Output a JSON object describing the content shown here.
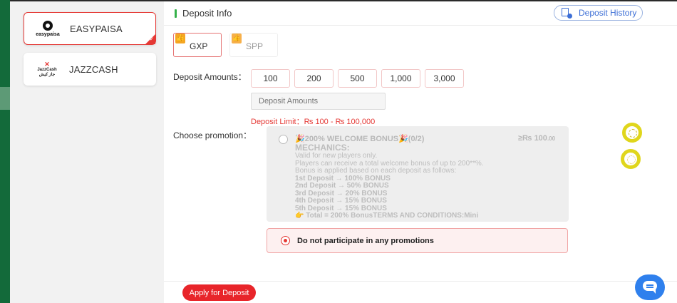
{
  "sidebar": {
    "methods": [
      {
        "name": "EASYPAISA",
        "logo_text": "easypaisa",
        "active": true
      },
      {
        "name": "JAZZCASH",
        "logo_text": "JazzCash",
        "logo_subtext": "جاز کیش",
        "active": false
      }
    ]
  },
  "header": {
    "title": "Deposit Info",
    "history_button": "Deposit History"
  },
  "currencies": [
    {
      "label": "GXP",
      "active": true
    },
    {
      "label": "SPP",
      "active": false
    }
  ],
  "deposit": {
    "amounts_label": "Deposit Amounts：",
    "amounts": [
      "100",
      "200",
      "500",
      "1,000",
      "3,000"
    ],
    "amount_placeholder": "Deposit Amounts",
    "limit_text": "Deposit Limit：₨ 100 - ₨ 100,000"
  },
  "promotion": {
    "label": "Choose promotion：",
    "title": "🎉200% WELCOME BONUS🎉(0/2)",
    "amount": "≥₨ 100",
    "amount_decimals": ".00",
    "mechanics_heading": "MECHANICS:",
    "lines": [
      "Valid for new players only.",
      "Players can receive a total welcome bonus of up to 200**%.",
      "Bonus is applied based on each deposit as follows:",
      "1st Deposit → 100% BONUS",
      "2nd Deposit → 50% BONUS",
      "3rd Deposit → 20% BONUS",
      "4th Deposit → 15% BONUS",
      "5th Deposit → 15% BONUS",
      "👉 Total = 200% BonusTERMS AND CONDITIONS:Mini"
    ],
    "no_promo_label": "Do not participate in any promotions"
  },
  "footer": {
    "apply_label": "Apply for Deposit"
  },
  "colors": {
    "brand_red": "#e8252a",
    "accent_green": "#35b14a",
    "link_blue": "#3d6fd6"
  }
}
